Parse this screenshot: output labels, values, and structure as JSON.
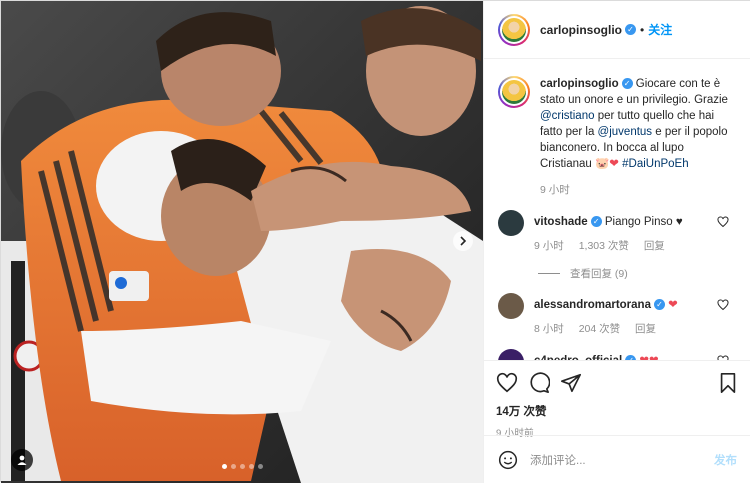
{
  "post": {
    "author": "carlopinsoglio",
    "follow_label": "关注",
    "caption_user": "carlopinsoglio",
    "caption_parts": [
      " Giocare con te è stato un onore e un privilegio. Grazie ",
      "@cristiano",
      " per tutto quello che hai fatto per la ",
      "@juventus",
      " e per il popolo bianconero. In bocca al lupo Cristianau 🐷",
      "❤",
      " ",
      "#DaiUnPoEh"
    ],
    "caption_time": "9 小时"
  },
  "comments": [
    {
      "user": "vitoshade",
      "text": " Piango Pinso ♥",
      "time": "9 小时",
      "likes": "1,303 次赞",
      "reply": "回复",
      "view_replies": "查看回复 (9)",
      "avatar_color": "#2b3a3f"
    },
    {
      "user": "alessandromartorana",
      "text": " ",
      "hearts": "❤",
      "time": "8 小时",
      "likes": "204 次赞",
      "reply": "回复",
      "avatar_color": "#6b5a48"
    },
    {
      "user": "c4pedro_official",
      "text": " ",
      "hearts": "❤❤",
      "avatar_color": "#3a1f66"
    }
  ],
  "actions": {
    "likes_count": "14万 次赞",
    "posted_ago": "9 小时前"
  },
  "add_comment": {
    "placeholder": "添加评论...",
    "post_label": "发布"
  },
  "carousel": {
    "total": 5,
    "active": 1
  },
  "colors": {
    "accent": "#0095f6",
    "link": "#00376b",
    "heart": "#ed4956",
    "verified": "#3897f0"
  },
  "icons": [
    "emoji-icon",
    "heart-icon",
    "comment-icon",
    "share-icon",
    "bookmark-icon",
    "more-icon",
    "tag-people-icon",
    "carousel-next-icon"
  ]
}
